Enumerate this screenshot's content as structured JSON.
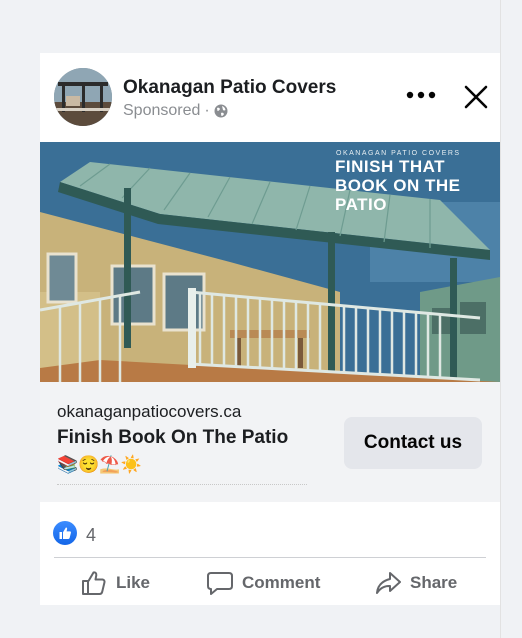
{
  "post": {
    "page_name": "Okanagan Patio Covers",
    "sponsored_label": "Sponsored",
    "separator": "·",
    "icons": {
      "more": "more-options-icon",
      "close": "close-icon",
      "audience": "globe-icon"
    }
  },
  "creative": {
    "brand_text": "OKANAGAN PATIO COVERS",
    "headline": "FINISH THAT BOOK ON THE PATIO"
  },
  "link": {
    "domain": "okanaganpatiocovers.ca",
    "title": "Finish Book On The Patio",
    "emojis": "📚😌⛱️☀️",
    "cta_label": "Contact us"
  },
  "reactions": {
    "icon": "like-reaction-icon",
    "count": "4"
  },
  "actions": {
    "like": "Like",
    "comment": "Comment",
    "share": "Share"
  },
  "colors": {
    "page_bg": "#f0f2f5",
    "card_bg": "#ffffff",
    "link_section_bg": "#f2f3f5",
    "cta_bg": "#e4e6eb",
    "like_blue": "#1877f2",
    "text_primary": "#1c1e21",
    "text_secondary": "#65676b"
  }
}
